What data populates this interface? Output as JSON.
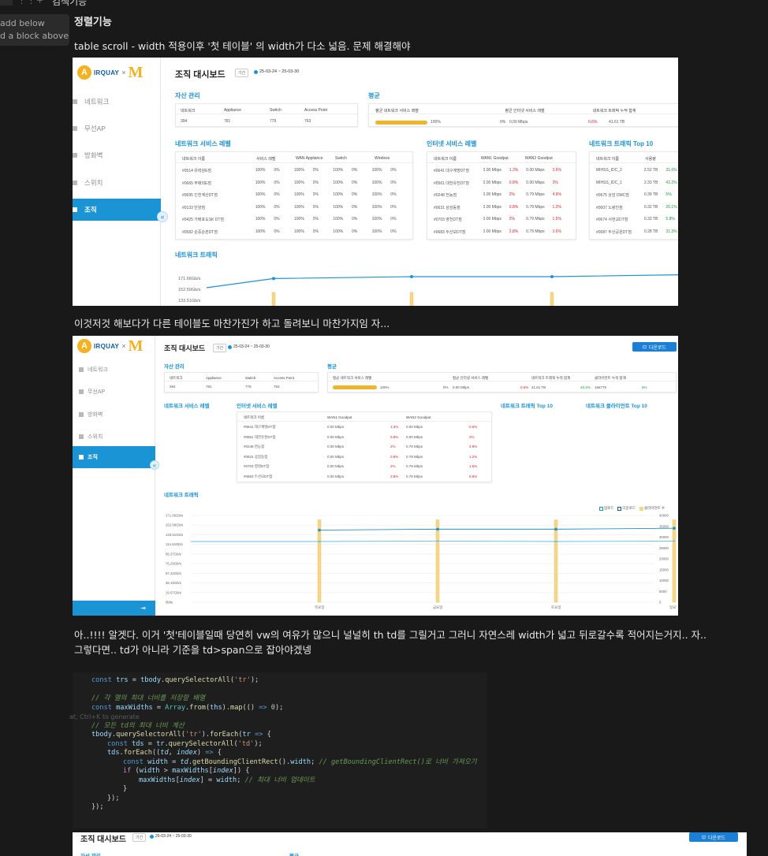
{
  "topbar": {
    "dots": "⋮⋮",
    "plus": "+",
    "text": "검색기능"
  },
  "tooltip": {
    "line1": "add below",
    "line2": "d a block above"
  },
  "notes": {
    "heading": "정렬기능",
    "line1": "table scroll - width 적용이후 '첫 테이블' 의 width가 다소 넓음. 문제 해결해야",
    "line2": "이것저것 해보다가 다른 테이블도 마찬가진가 하고 돌려보니 마찬가지임 자...",
    "line3": "아..!!!! 알겟다. 이거 '첫'테이블일때 당연히 vw의 여유가 많으니 널널히 th td를 그릴거고 그러니 자연스레 width가 넓고 뒤로갈수록 적어지는거지.. 자..",
    "line4": "그렇다면.. td가 아니라 기준을 td>span으로 잡아야겠넹"
  },
  "dashboard": {
    "logo_text": "IRQUAY",
    "logo_a": "A",
    "logo_x": "×",
    "logo_m": "M",
    "title": "조직 대시보드",
    "badge": "기간",
    "date_range": "25-03-24 ~ 25-03-30",
    "download": "다운로드",
    "collapse": "«",
    "sidebar": [
      "네트워크",
      "무선AP",
      "방화벽",
      "스위치",
      "조직"
    ],
    "asset": {
      "title": "자산 관리",
      "headers": [
        "네트워크",
        "Appliance",
        "Switch",
        "Access Point"
      ],
      "values": [
        "394",
        "781",
        "779",
        "763"
      ]
    },
    "average": {
      "title": "평균",
      "headers": [
        "평균 네트워크 서비스 레벨",
        "평균 인터넷 서비스 레벨",
        "네트워크 트래픽 누적 합계",
        "클라이언트 누적 합계"
      ],
      "service_pct": "100%",
      "internet": "0.00 Mbps",
      "internet_delta": "0%",
      "traffic": "41.61 TB",
      "traffic_delta": "0.6%",
      "clients": "166775",
      "clients_delta": "40.2%",
      "clients_delta2": "6%"
    },
    "service_level": {
      "title": "네트워크 서비스 레벨",
      "headers": [
        "네트워크 이름",
        "서비스 레벨",
        "WAN Appliance",
        "Switch",
        "Wireless"
      ],
      "rows": [
        [
          "#0514 유력원E점",
          "100%",
          "0%",
          "100%",
          "0%",
          "100%",
          "0%",
          "100%",
          "0%"
        ],
        [
          "#0665 부때외E점",
          "100%",
          "0%",
          "100%",
          "0%",
          "100%",
          "0%",
          "100%",
          "0%"
        ],
        [
          "#0695 인천계산DT점",
          "100%",
          "0%",
          "100%",
          "0%",
          "100%",
          "0%",
          "100%",
          "0%"
        ],
        [
          "#0133 안양점",
          "100%",
          "0%",
          "100%",
          "0%",
          "100%",
          "0%",
          "100%",
          "0%"
        ],
        [
          "#0425 가배포도SK DT점",
          "100%",
          "0%",
          "100%",
          "0%",
          "100%",
          "0%",
          "100%",
          "0%"
        ],
        [
          "#0582 순중순촌DT점",
          "100%",
          "0%",
          "100%",
          "0%",
          "100%",
          "0%",
          "100%",
          "0%"
        ]
      ]
    },
    "internet_level": {
      "title": "인터넷 서비스 레벨",
      "headers": [
        "네트워크 이름",
        "WAN1 Goodput",
        "WAN2 Goodput"
      ],
      "rows": [
        [
          "#0641 대구계명DT점",
          "0.00 Mbps",
          "1.3%",
          "0.00 Mbps",
          "0.6%"
        ],
        [
          "#0561 대전유천DT점",
          "0.00 Mbps",
          "0.8%",
          "0.00 Mbps",
          "2%"
        ],
        [
          "#0248 천능점",
          "0.00 Mbps",
          "2%",
          "0.79 Mbps",
          "4.9%"
        ],
        [
          "#0631 상암동점",
          "0.00 Mbps",
          "0.8%",
          "0.79 Mbps",
          "1.2%"
        ],
        [
          "#0703 영천DT점",
          "0.00 Mbps",
          "2%",
          "0.79 Mbps",
          "1.5%"
        ],
        [
          "#0683 두산모DT점",
          "0.00 Mbps",
          "2.8%",
          "0.79 Mbps",
          "0.6%"
        ]
      ]
    },
    "traffic_top": {
      "title": "네트워크 트래픽 Top 10",
      "headers": [
        "네트워크 이름",
        "사용량"
      ],
      "rows": [
        [
          "MIHSS_IDC_2",
          "2.52 TB",
          "31.6%"
        ],
        [
          "MIHSS_IDC_1",
          "2.33 TB",
          "42.2%"
        ],
        [
          "#0675 상암 DMC점",
          "0.39 TB",
          "5%"
        ],
        [
          "#0007 노량진점",
          "0.32 TB",
          "26.1%"
        ],
        [
          "#0674 서현교DT점",
          "0.32 TB",
          "5.8%"
        ],
        [
          "#0087 두산공원DT점",
          "0.28 TB",
          "31.3%"
        ]
      ]
    },
    "client_top": {
      "title": "네트워크 클라이언트 Top 10"
    },
    "traffic_chart": {
      "title": "네트워크 트래픽",
      "legend": [
        "업로드",
        "다운로드",
        "클라이언트 수"
      ]
    }
  },
  "chart_data": {
    "type": "bar",
    "categories": [
      "목요일",
      "금요일",
      "토요일",
      "일요일"
    ],
    "y_ticks_left": [
      "171.66Gb/s",
      "152.59Gb/s",
      "133.51Gb/s",
      "114.44Gb/s",
      "95.37Gb/s",
      "76.29Gb/s",
      "57.22Gb/s",
      "38.15Gb/s",
      "19.07Gb/s",
      "0bits"
    ],
    "y_ticks_right": [
      "40000",
      "35000",
      "30000",
      "25000",
      "20000",
      "15000",
      "10000",
      "5000",
      "0"
    ],
    "ylim_right": [
      0,
      40000
    ],
    "series": [
      {
        "name": "업로드",
        "values": [
          158,
          160,
          160,
          162
        ]
      },
      {
        "name": "다운로드",
        "values": [
          133,
          134,
          133,
          134
        ]
      },
      {
        "name": "클라이언트 수",
        "values": [
          38000,
          38000,
          38000,
          38000
        ]
      }
    ],
    "colors": {
      "upload": "#1b94d6",
      "download": "#5bc0f0",
      "clients": "#f6d78a"
    }
  },
  "code": {
    "ghost": "at, Ctrl+K to generate"
  },
  "colors": {
    "background": "#191919",
    "accent": "#1b94d6",
    "brand": "#f4b120"
  }
}
